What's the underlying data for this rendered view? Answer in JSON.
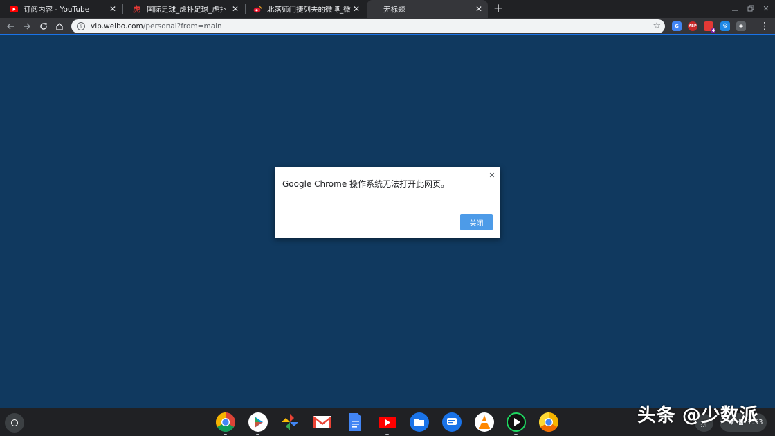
{
  "tabs": [
    {
      "title": "订阅内容 - YouTube",
      "icon": "youtube-icon"
    },
    {
      "title": "国际足球_虎扑足球_虎扑",
      "icon": "hupu-icon"
    },
    {
      "title": "北落师门捷列夫的微博_微博",
      "icon": "weibo-icon"
    },
    {
      "title": "无标题",
      "icon": "none"
    }
  ],
  "omnibox": {
    "domain": "vip.weibo.com",
    "path": "/personal?from=main"
  },
  "extensions": [
    {
      "name": "translate-extension-icon",
      "label": "G"
    },
    {
      "name": "adblock-plus-extension-icon",
      "label": "ABP"
    },
    {
      "name": "extension-badge-icon",
      "label": "4"
    },
    {
      "name": "settings-extension-icon",
      "label": "⚙"
    },
    {
      "name": "shield-extension-icon",
      "label": "◈"
    }
  ],
  "dialog": {
    "message": "Google Chrome 操作系统无法打开此网页。",
    "button": "关闭"
  },
  "shelf": {
    "apps": [
      "chrome",
      "play-store",
      "photos",
      "gmail",
      "docs",
      "youtube",
      "files",
      "messages",
      "vlc",
      "media-player",
      "chrome-canary"
    ],
    "ime": "拼",
    "time": "1:53"
  },
  "watermark": "头条 @少数派",
  "colors": {
    "desktop": "#10395f",
    "accent": "#1a73e8",
    "button": "#4d9be8"
  }
}
